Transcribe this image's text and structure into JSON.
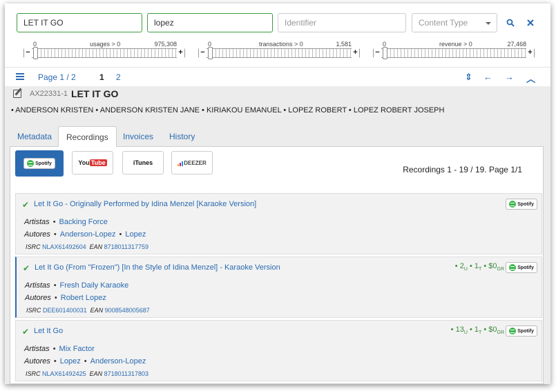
{
  "search": {
    "title_value": "LET IT GO",
    "author_value": "lopez",
    "identifier_placeholder": "Identifier",
    "content_type": "Content Type"
  },
  "sliders": [
    {
      "min": "0",
      "label": "usages > 0",
      "max": "975,308"
    },
    {
      "min": "0",
      "label": "transactions > 0",
      "max": "1,581"
    },
    {
      "min": "0",
      "label": "revenue > 0",
      "max": "27,468"
    }
  ],
  "pager": {
    "page_label": "Page 1 / 2",
    "page1": "1",
    "page2": "2"
  },
  "work": {
    "code": "AX22331-1",
    "title": "LET IT GO",
    "authors": "• ANDERSON KRISTEN • ANDERSON KRISTEN JANE • KIRIAKOU EMANUEL • LOPEZ ROBERT • LOPEZ ROBERT JOSEPH"
  },
  "tabs": [
    "Metadata",
    "Recordings",
    "Invoices",
    "History"
  ],
  "sources": [
    "Spotify",
    "YouTube",
    "iTunes",
    "DEEZER"
  ],
  "recordings_count": "Recordings 1 - 19 / 19. Page 1/1",
  "labels": {
    "artists": "Artistas",
    "authors": "Autores",
    "isrc": "ISRC",
    "ean": "EAN"
  },
  "recordings": [
    {
      "title": "Let It Go - Originally Performed by Idina Menzel [Karaoke Version]",
      "artists": [
        "Backing Force"
      ],
      "authors": [
        "Anderson-Lopez",
        "Lopez"
      ],
      "isrc": "NLAX61492604",
      "ean": "8718011317759",
      "stats": {
        "usages": "",
        "transactions": "",
        "revenue": ""
      }
    },
    {
      "title": "Let It Go (From \"Frozen\") [In the Style of Idina Menzel] - Karaoke Version",
      "artists": [
        "Fresh Daily Karaoke"
      ],
      "authors": [
        "Robert Lopez"
      ],
      "isrc": "DEE601400031",
      "ean": "9008548005687",
      "stats": {
        "usages": "2",
        "transactions": "1",
        "revenue": "$0"
      }
    },
    {
      "title": "Let It Go",
      "artists": [
        "Mix Factor"
      ],
      "authors": [
        "Lopez",
        "Anderson-Lopez"
      ],
      "isrc": "NLAX61492425",
      "ean": "8718011317803",
      "stats": {
        "usages": "13",
        "transactions": "1",
        "revenue": "$0"
      }
    }
  ],
  "stat_suffix": {
    "usages": "U",
    "transactions": "T",
    "revenue": "GR"
  },
  "badge_label": "Spotify",
  "colors": {
    "link": "#2a6ab0",
    "ok": "#3c9b40",
    "spotify": "#3ab54a"
  }
}
